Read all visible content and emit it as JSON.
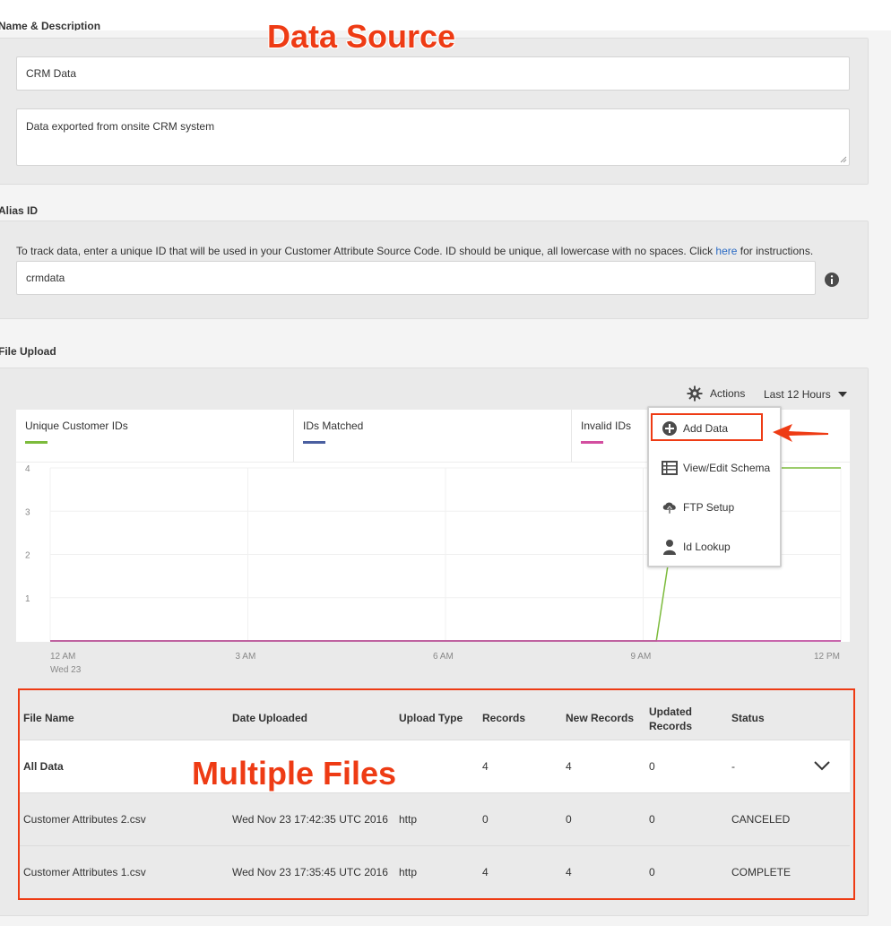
{
  "annotations": {
    "data_source": "Data Source",
    "multiple_files": "Multiple Files"
  },
  "name_section": {
    "label": "Name & Description",
    "name_value": "CRM Data",
    "description_value": "Data exported from onsite CRM system"
  },
  "alias_section": {
    "label": "Alias ID",
    "help_prefix": "To track data, enter a unique ID that will be used in your Customer Attribute Source Code. ID should be unique, all lowercase with no spaces. Click ",
    "help_link": "here",
    "help_suffix": " for instructions.",
    "alias_value": "crmdata",
    "info_icon": "info-icon"
  },
  "upload_section": {
    "label": "File Upload",
    "actions_label": "Actions",
    "actions_icon": "gear-icon",
    "time_range": "Last 12 Hours",
    "legend": [
      {
        "label": "Unique Customer IDs",
        "color": "#7cbb3c"
      },
      {
        "label": "IDs Matched",
        "color": "#4a5fa0"
      },
      {
        "label": "Invalid IDs",
        "color": "#d34ea0"
      }
    ],
    "menu": [
      {
        "label": "Add Data",
        "icon": "plus-circle-icon"
      },
      {
        "label": "View/Edit Schema",
        "icon": "table-icon"
      },
      {
        "label": "FTP Setup",
        "icon": "cloud-upload-icon"
      },
      {
        "label": "Id Lookup",
        "icon": "person-icon"
      }
    ]
  },
  "chart_data": {
    "type": "line",
    "y_ticks": [
      "4",
      "3",
      "2",
      "1"
    ],
    "ylim": [
      0,
      4
    ],
    "x_ticks": [
      "12 AM",
      "3 AM",
      "6 AM",
      "9 AM",
      "12 PM"
    ],
    "x_sublabel": "Wed 23",
    "xlim_hours": [
      0,
      12
    ],
    "series": [
      {
        "name": "Unique Customer IDs",
        "color": "#7cbb3c",
        "points": [
          [
            0,
            0
          ],
          [
            9.2,
            0
          ],
          [
            9.6,
            4
          ],
          [
            12,
            4
          ]
        ]
      },
      {
        "name": "IDs Matched",
        "color": "#4a5fa0",
        "points": [
          [
            0,
            0
          ],
          [
            12,
            0
          ]
        ]
      },
      {
        "name": "Invalid IDs",
        "color": "#d34ea0",
        "points": [
          [
            0,
            0
          ],
          [
            12,
            0
          ]
        ]
      }
    ],
    "grid": true
  },
  "table": {
    "headers": [
      "File Name",
      "Date Uploaded",
      "Upload Type",
      "Records",
      "New Records",
      "Updated Records",
      "Status"
    ],
    "summary": {
      "file_name": "All Data",
      "records": "4",
      "new_records": "4",
      "updated_records": "0",
      "status": "-"
    },
    "rows": [
      {
        "file_name": "Customer Attributes 2.csv",
        "date": "Wed Nov 23 17:42:35 UTC 2016",
        "type": "http",
        "records": "0",
        "new_records": "0",
        "updated_records": "0",
        "status": "CANCELED"
      },
      {
        "file_name": "Customer Attributes 1.csv",
        "date": "Wed Nov 23 17:35:45 UTC 2016",
        "type": "http",
        "records": "4",
        "new_records": "4",
        "updated_records": "0",
        "status": "COMPLETE"
      }
    ]
  }
}
